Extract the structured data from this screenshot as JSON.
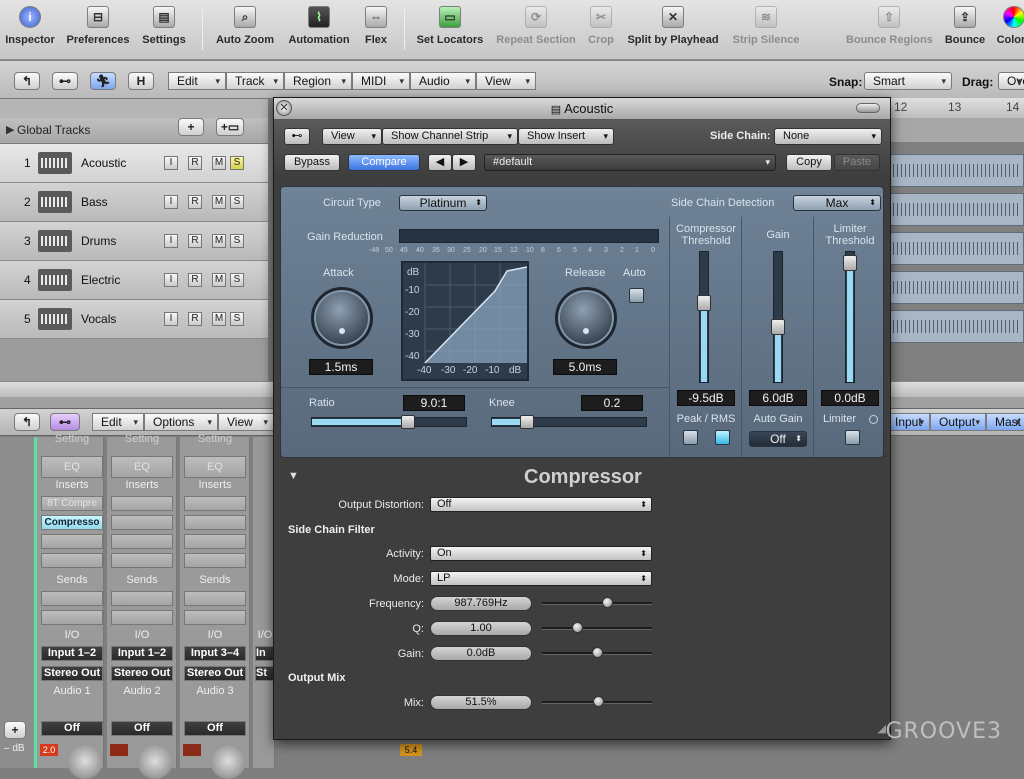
{
  "toolbar": {
    "inspector": "Inspector",
    "preferences": "Preferences",
    "settings": "Settings",
    "auto_zoom": "Auto Zoom",
    "automation": "Automation",
    "flex": "Flex",
    "set_locators": "Set Locators",
    "repeat_section": "Repeat Section",
    "crop": "Crop",
    "split_by_playhead": "Split by Playhead",
    "strip_silence": "Strip Silence",
    "bounce_regions": "Bounce Regions",
    "bounce": "Bounce",
    "colors": "Colors"
  },
  "arrange_bar": {
    "h_btn": "H",
    "menus": [
      "Edit",
      "Track",
      "Region",
      "MIDI",
      "Audio",
      "View"
    ],
    "snap_label": "Snap:",
    "snap_value": "Smart",
    "drag_label": "Drag:",
    "drag_value": "Ove"
  },
  "tracks": {
    "global_tracks": "Global Tracks",
    "items": [
      {
        "num": "1",
        "name": "Acoustic"
      },
      {
        "num": "2",
        "name": "Bass"
      },
      {
        "num": "3",
        "name": "Drums"
      },
      {
        "num": "4",
        "name": "Electric"
      },
      {
        "num": "5",
        "name": "Vocals"
      }
    ],
    "irms": [
      "I",
      "R",
      "M",
      "S"
    ]
  },
  "ruler": [
    "12",
    "13",
    "14"
  ],
  "mixer": {
    "menus": [
      "Edit",
      "Options",
      "View"
    ],
    "right_buttons": [
      "Input",
      "Output",
      "Mast"
    ],
    "strips": [
      {
        "setting": "Setting",
        "eq": "EQ",
        "inserts": "Inserts",
        "slot1": "8T Compre",
        "slot2": "Compresso",
        "sends": "Sends",
        "io": "I/O",
        "input": "Input 1–2",
        "output": "Stereo Out",
        "name": "Audio 1",
        "auto": "Off",
        "peak": "2.0"
      },
      {
        "setting": "Setting",
        "eq": "EQ",
        "inserts": "Inserts",
        "slot1": "",
        "slot2": "",
        "sends": "Sends",
        "io": "I/O",
        "input": "Input 1–2",
        "output": "Stereo Out",
        "name": "Audio 2",
        "auto": "Off",
        "peak": ""
      },
      {
        "setting": "Setting",
        "eq": "EQ",
        "inserts": "Inserts",
        "slot1": "",
        "slot2": "",
        "sends": "Sends",
        "io": "I/O",
        "input": "Input 3–4",
        "output": "Stereo Out",
        "name": "Audio 3",
        "auto": "Off",
        "peak": ""
      },
      {
        "setting": "",
        "eq": "",
        "inserts": "",
        "slot1": "",
        "slot2": "",
        "sends": "",
        "io": "I/O",
        "input": "In",
        "output": "St",
        "name": "",
        "auto": "",
        "peak": "5.4"
      }
    ],
    "db_label": "– dB"
  },
  "plugin": {
    "title": "Acoustic",
    "view_menu": "View",
    "show_channel_strip": "Show Channel Strip",
    "show_insert": "Show Insert",
    "side_chain_label": "Side Chain:",
    "side_chain_value": "None",
    "bypass": "Bypass",
    "compare": "Compare",
    "preset": "#default",
    "copy": "Copy",
    "paste": "Paste",
    "circuit_type_label": "Circuit Type",
    "circuit_type_value": "Platinum",
    "sc_detection_label": "Side Chain Detection",
    "sc_detection_value": "Max",
    "gain_reduction_label": "Gain Reduction",
    "gr_scale": [
      "-48",
      "50",
      "45",
      "40",
      "35",
      "30",
      "25",
      "20",
      "15",
      "12",
      "10",
      "8",
      "6",
      "5",
      "4",
      "3",
      "2",
      "1",
      "0"
    ],
    "attack_label": "Attack",
    "attack_value": "1.5ms",
    "release_label": "Release",
    "release_value": "5.0ms",
    "auto_label": "Auto",
    "graph_y": [
      "dB",
      "-10",
      "-20",
      "-30",
      "-40"
    ],
    "graph_x": [
      "-40",
      "-30",
      "-20",
      "-10",
      "dB"
    ],
    "comp_threshold_label": "Compressor Threshold",
    "comp_threshold_value": "-9.5dB",
    "comp_threshold_level": 0.63,
    "gain_label": "Gain",
    "gain_value": "6.0dB",
    "gain_level": 0.42,
    "limiter_threshold_label": "Limiter Threshold",
    "limiter_threshold_value": "0.0dB",
    "limiter_threshold_level": 0.97,
    "ratio_label": "Ratio",
    "ratio_value": "9.0:1",
    "ratio_level": 0.63,
    "knee_label": "Knee",
    "knee_value": "0.2",
    "knee_level": 0.2,
    "peak_rms_label": "Peak / RMS",
    "auto_gain_label": "Auto Gain",
    "auto_gain_value": "Off",
    "limiter_label": "Limiter",
    "plugin_name": "Compressor",
    "output_distortion_label": "Output Distortion:",
    "output_distortion_value": "Off",
    "side_chain_filter_head": "Side Chain Filter",
    "activity_label": "Activity:",
    "activity_value": "On",
    "mode_label": "Mode:",
    "mode_value": "LP",
    "frequency_label": "Frequency:",
    "frequency_value": "987.769Hz",
    "frequency_level": 0.61,
    "q_label": "Q:",
    "q_value": "1.00",
    "q_level": 0.3,
    "gain2_label": "Gain:",
    "gain2_value": "0.0dB",
    "gain2_level": 0.5,
    "output_mix_head": "Output Mix",
    "mix_label": "Mix:",
    "mix_value": "51.5%",
    "mix_level": 0.52
  },
  "watermark": "GROOVE3"
}
